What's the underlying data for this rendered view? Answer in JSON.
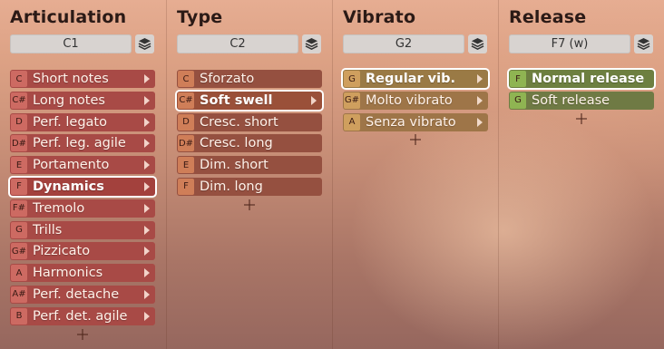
{
  "columns": [
    {
      "id": "articulation",
      "title": "Articulation",
      "key": "C1",
      "palette": {
        "item": "#a84a46",
        "key": "#cd6a62"
      },
      "items": [
        {
          "key": "C",
          "label": "Short notes",
          "selected": false
        },
        {
          "key": "C#",
          "label": "Long notes",
          "selected": false
        },
        {
          "key": "D",
          "label": "Perf. legato",
          "selected": false
        },
        {
          "key": "D#",
          "label": "Perf. leg. agile",
          "selected": false
        },
        {
          "key": "E",
          "label": "Portamento",
          "selected": false
        },
        {
          "key": "F",
          "label": "Dynamics",
          "selected": true
        },
        {
          "key": "F#",
          "label": "Tremolo",
          "selected": false
        },
        {
          "key": "G",
          "label": "Trills",
          "selected": false
        },
        {
          "key": "G#",
          "label": "Pizzicato",
          "selected": false
        },
        {
          "key": "A",
          "label": "Harmonics",
          "selected": false
        },
        {
          "key": "A#",
          "label": "Perf. detache",
          "selected": false
        },
        {
          "key": "B",
          "label": "Perf. det. agile",
          "selected": false
        }
      ]
    },
    {
      "id": "type",
      "title": "Type",
      "key": "C2",
      "palette": {
        "item": "#955040",
        "key": "#cf7e58"
      },
      "items": [
        {
          "key": "C",
          "label": "Sforzato",
          "selected": false
        },
        {
          "key": "C#",
          "label": "Soft swell",
          "selected": true
        },
        {
          "key": "D",
          "label": "Cresc. short",
          "selected": false
        },
        {
          "key": "D#",
          "label": "Cresc. long",
          "selected": false
        },
        {
          "key": "E",
          "label": "Dim. short",
          "selected": false
        },
        {
          "key": "F",
          "label": "Dim. long",
          "selected": false
        }
      ]
    },
    {
      "id": "vibrato",
      "title": "Vibrato",
      "key": "G2",
      "palette": {
        "item": "#9e7548",
        "key": "#cf9f5e"
      },
      "items": [
        {
          "key": "G",
          "label": "Regular vib.",
          "selected": true
        },
        {
          "key": "G#",
          "label": "Molto vibrato",
          "selected": false
        },
        {
          "key": "A",
          "label": "Senza vibrato",
          "selected": false
        }
      ]
    },
    {
      "id": "release",
      "title": "Release",
      "key": "F7 (w)",
      "palette": {
        "item": "#6f7a44",
        "key": "#8fb452"
      },
      "items": [
        {
          "key": "F",
          "label": "Normal release",
          "selected": true,
          "arrow": false
        },
        {
          "key": "G",
          "label": "Soft release",
          "selected": false,
          "arrow": false
        }
      ]
    }
  ],
  "icons": {
    "layers": "layers-icon",
    "add": "plus-icon",
    "submenu": "chevron-right-icon"
  }
}
